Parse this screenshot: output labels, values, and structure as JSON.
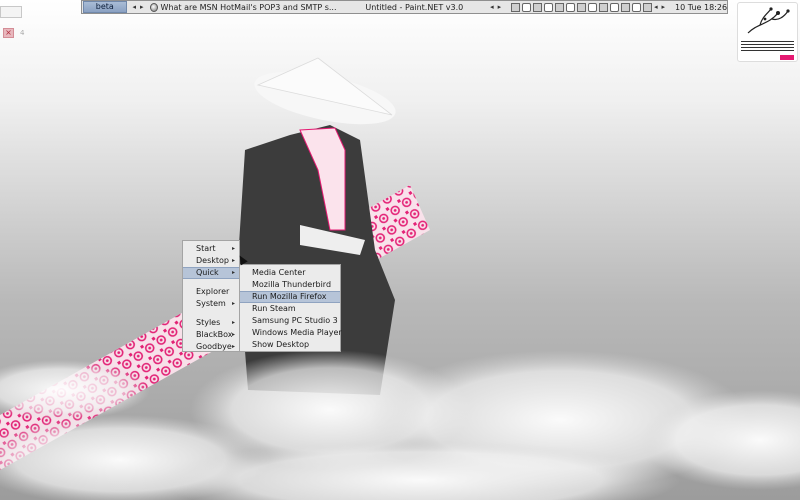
{
  "toolbar": {
    "workspace": "beta",
    "left_arrow": "◂",
    "right_arrow": "▸",
    "task_1": "What are MSN HotMail's POP3 and SMTP s...",
    "task_2": "Untitled - Paint.NET v3.0",
    "clock": "10 Tue 18:26"
  },
  "tray": {
    "close_glyph": "×",
    "count": "4"
  },
  "root_menu": {
    "items": [
      {
        "label": "Start",
        "has_submenu": true
      },
      {
        "label": "Desktop",
        "has_submenu": true
      },
      {
        "label": "Quick",
        "has_submenu": true
      },
      {
        "label": "Explorer",
        "has_submenu": false
      },
      {
        "label": "System",
        "has_submenu": true
      },
      {
        "label": "Styles",
        "has_submenu": true
      },
      {
        "label": "BlackBox",
        "has_submenu": true
      },
      {
        "label": "Goodbye",
        "has_submenu": true
      }
    ],
    "submenu_arrow": "▸"
  },
  "quick_menu": {
    "items": [
      {
        "label": "Media Center"
      },
      {
        "label": "Mozilla Thunderbird"
      },
      {
        "label": "Run Mozilla Firefox",
        "selected": true
      },
      {
        "label": "Run Steam"
      },
      {
        "label": "Samsung PC Studio 3"
      },
      {
        "label": "Windows Media Player"
      },
      {
        "label": "Show Desktop"
      }
    ]
  },
  "colors": {
    "accent_pink": "#e51a72",
    "menu_highlight": "#b6c4d8",
    "workspace_blue": "#8aa1c2"
  }
}
